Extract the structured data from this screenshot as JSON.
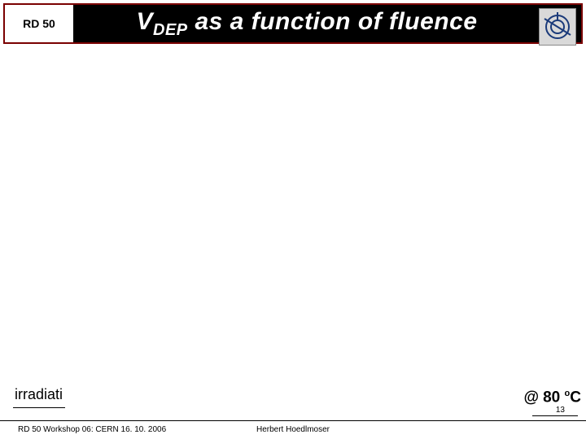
{
  "header": {
    "badge": "RD 50",
    "title_v": "V",
    "title_sub": "DEP",
    "title_rest": " as a function of fluence"
  },
  "body": {
    "irradiati": "irradiati"
  },
  "temp": {
    "at": "@",
    "value": " 80 ",
    "unit_sup": "o",
    "unit": "C"
  },
  "page_number": "13",
  "footer": {
    "left": "RD 50 Workshop 06: CERN 16. 10. 2006",
    "center": "Herbert Hoedlmoser"
  }
}
